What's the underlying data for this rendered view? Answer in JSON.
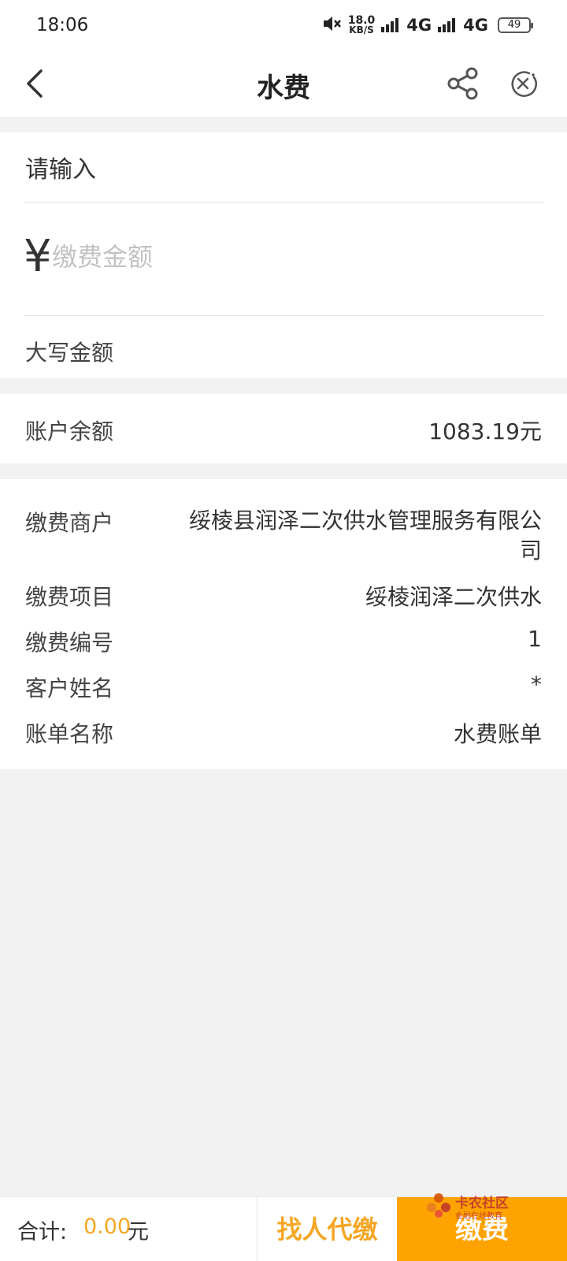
{
  "status": {
    "time": "18:06",
    "speed_value": "18.0",
    "speed_unit": "KB/S",
    "net1": "4G",
    "net2": "4G",
    "battery": "49"
  },
  "nav": {
    "title": "水费"
  },
  "form": {
    "input_label": "请输入",
    "currency_symbol": "¥",
    "amount_placeholder": "缴费金额",
    "upper_amount_label": "大写金额"
  },
  "account": {
    "balance_label": "账户余额",
    "balance_value": "1083.19元"
  },
  "details": [
    {
      "label": "缴费商户",
      "value": "绥棱县润泽二次供水管理服务有限公司"
    },
    {
      "label": "缴费项目",
      "value": "绥棱润泽二次供水"
    },
    {
      "label": "缴费编号",
      "value": "1"
    },
    {
      "label": "客户姓名",
      "value": "*"
    },
    {
      "label": "账单名称",
      "value": "水费账单"
    }
  ],
  "bottom": {
    "total_label": "合计:",
    "total_value": "0.00",
    "total_unit": "元",
    "proxy_pay_label": "找人代缴",
    "pay_label": "缴费"
  },
  "watermark": {
    "name": "卡农社区",
    "tagline": "金融在线教育"
  },
  "colors": {
    "accent": "#ffa300",
    "accent_text": "#f5a623"
  }
}
